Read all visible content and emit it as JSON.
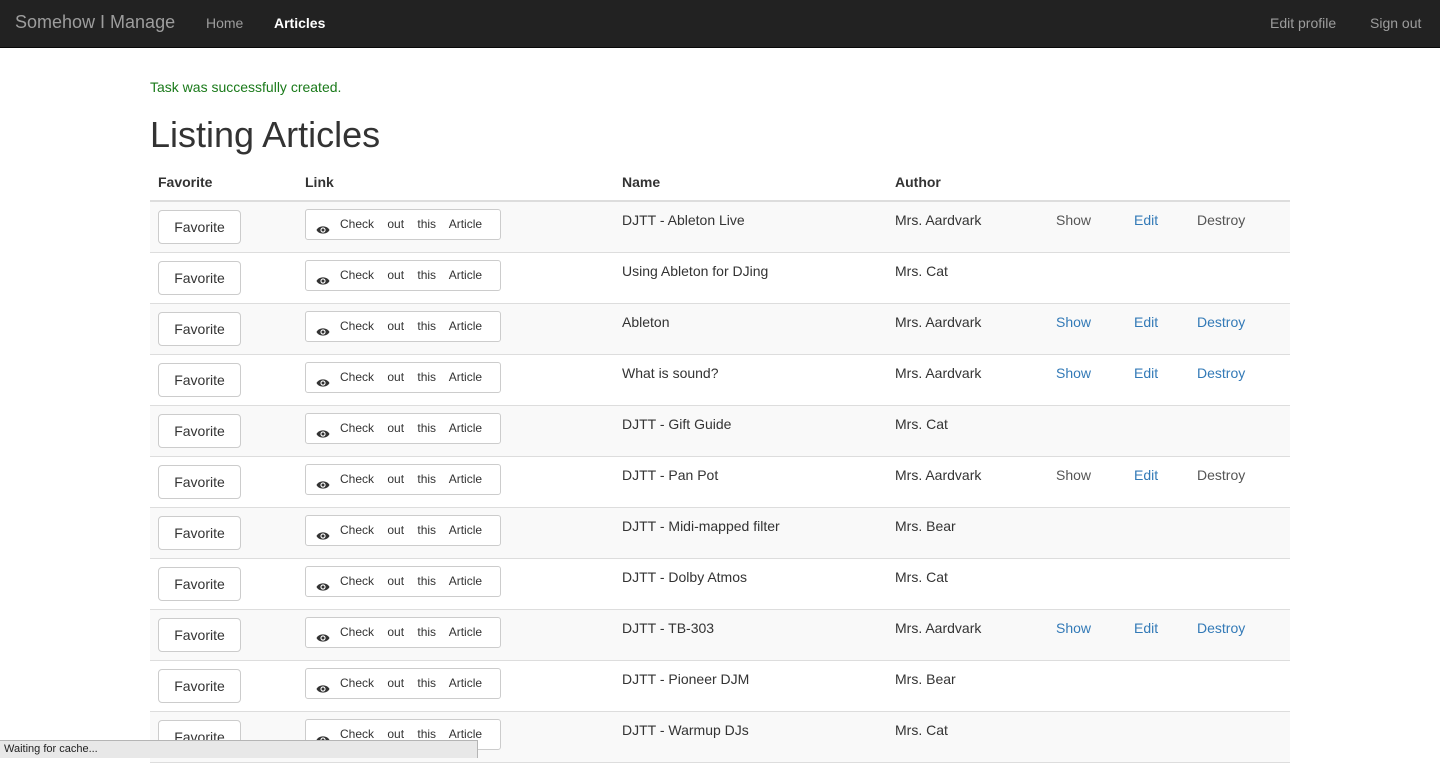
{
  "navbar": {
    "brand": "Somehow I Manage",
    "links": [
      {
        "label": "Home",
        "active": false
      },
      {
        "label": "Articles",
        "active": true
      }
    ],
    "right_links": [
      "Edit profile",
      "Sign out"
    ]
  },
  "notice": "Task was successfully created.",
  "page_title": "Listing Articles",
  "table": {
    "headers": {
      "favorite": "Favorite",
      "link": "Link",
      "name": "Name",
      "author": "Author"
    },
    "favorite_label": "Favorite",
    "link_label": "Check out this Article",
    "link_icon": "eye-icon",
    "rows": [
      {
        "name": "DJTT - Ableton Live",
        "author": "Mrs. Aardvark",
        "actions": {
          "show": "Show",
          "edit": "Edit",
          "destroy": "Destroy"
        },
        "show_color": "#555555",
        "destroy_color": "#555555"
      },
      {
        "name": "Using Ableton for DJing",
        "author": "Mrs. Cat",
        "actions": null
      },
      {
        "name": "Ableton",
        "author": "Mrs. Aardvark",
        "actions": {
          "show": "Show",
          "edit": "Edit",
          "destroy": "Destroy"
        },
        "show_color": "#337ab7",
        "destroy_color": "#337ab7"
      },
      {
        "name": "What is sound?",
        "author": "Mrs. Aardvark",
        "actions": {
          "show": "Show",
          "edit": "Edit",
          "destroy": "Destroy"
        },
        "show_color": "#337ab7",
        "destroy_color": "#337ab7"
      },
      {
        "name": "DJTT - Gift Guide",
        "author": "Mrs. Cat",
        "actions": null
      },
      {
        "name": "DJTT - Pan Pot",
        "author": "Mrs. Aardvark",
        "actions": {
          "show": "Show",
          "edit": "Edit",
          "destroy": "Destroy"
        },
        "show_color": "#555555",
        "destroy_color": "#555555"
      },
      {
        "name": "DJTT - Midi-mapped filter",
        "author": "Mrs. Bear",
        "actions": null
      },
      {
        "name": "DJTT - Dolby Atmos",
        "author": "Mrs. Cat",
        "actions": null
      },
      {
        "name": "DJTT - TB-303",
        "author": "Mrs. Aardvark",
        "actions": {
          "show": "Show",
          "edit": "Edit",
          "destroy": "Destroy"
        },
        "show_color": "#337ab7",
        "destroy_color": "#337ab7"
      },
      {
        "name": "DJTT - Pioneer DJM",
        "author": "Mrs. Bear",
        "actions": null
      },
      {
        "name": "DJTT - Warmup DJs",
        "author": "Mrs. Cat",
        "actions": null
      }
    ]
  },
  "status_bar": "Waiting for cache...",
  "colors": {
    "edit_link": "#337ab7",
    "notice": "#1a7a1a",
    "navbar": "#222222"
  }
}
